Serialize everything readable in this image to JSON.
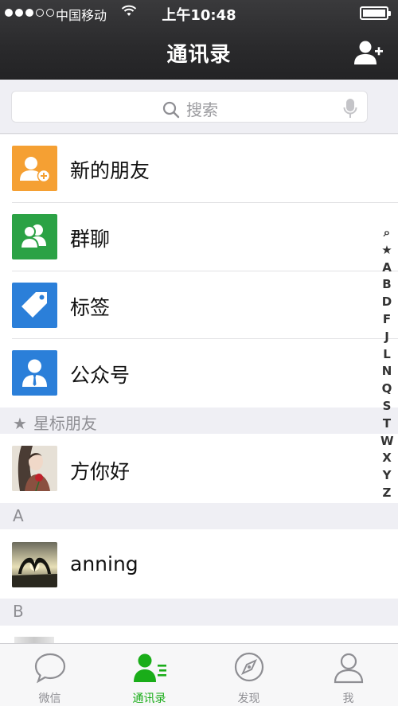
{
  "status_bar": {
    "carrier": "中国移动",
    "time": "上午10:48",
    "signal_bars": 3,
    "signal_total": 5,
    "battery_level": 1.0
  },
  "nav": {
    "title": "通讯录",
    "add_icon": "add-contact-icon"
  },
  "search": {
    "placeholder": "搜索",
    "icon": "search-icon",
    "mic_icon": "microphone-icon"
  },
  "functions": [
    {
      "label": "新的朋友",
      "icon": "new-friend-icon",
      "color": "#f5a033"
    },
    {
      "label": "群聊",
      "icon": "group-chat-icon",
      "color": "#2ba245"
    },
    {
      "label": "标签",
      "icon": "tag-icon",
      "color": "#2b7fd9"
    },
    {
      "label": "公众号",
      "icon": "official-account-icon",
      "color": "#2b7fd9"
    }
  ],
  "sections": {
    "starred": "星标朋友",
    "a": "A",
    "b": "B"
  },
  "contacts": {
    "starred": [
      {
        "name": "方你好",
        "avatar": "woman-with-rose-avatar"
      }
    ],
    "a": [
      {
        "name": "anning",
        "avatar": "heart-sunset-avatar"
      }
    ]
  },
  "index_letters": [
    "⌕",
    "★",
    "A",
    "B",
    "D",
    "F",
    "J",
    "L",
    "N",
    "Q",
    "S",
    "T",
    "W",
    "X",
    "Y",
    "Z"
  ],
  "tabs": [
    {
      "label": "微信",
      "icon": "chat-bubble-icon",
      "active": false
    },
    {
      "label": "通讯录",
      "icon": "contacts-icon",
      "active": true
    },
    {
      "label": "发现",
      "icon": "compass-icon",
      "active": false
    },
    {
      "label": "我",
      "icon": "profile-icon",
      "active": false
    }
  ],
  "colors": {
    "accent": "#1aad19",
    "header": "#2b2b2d"
  }
}
